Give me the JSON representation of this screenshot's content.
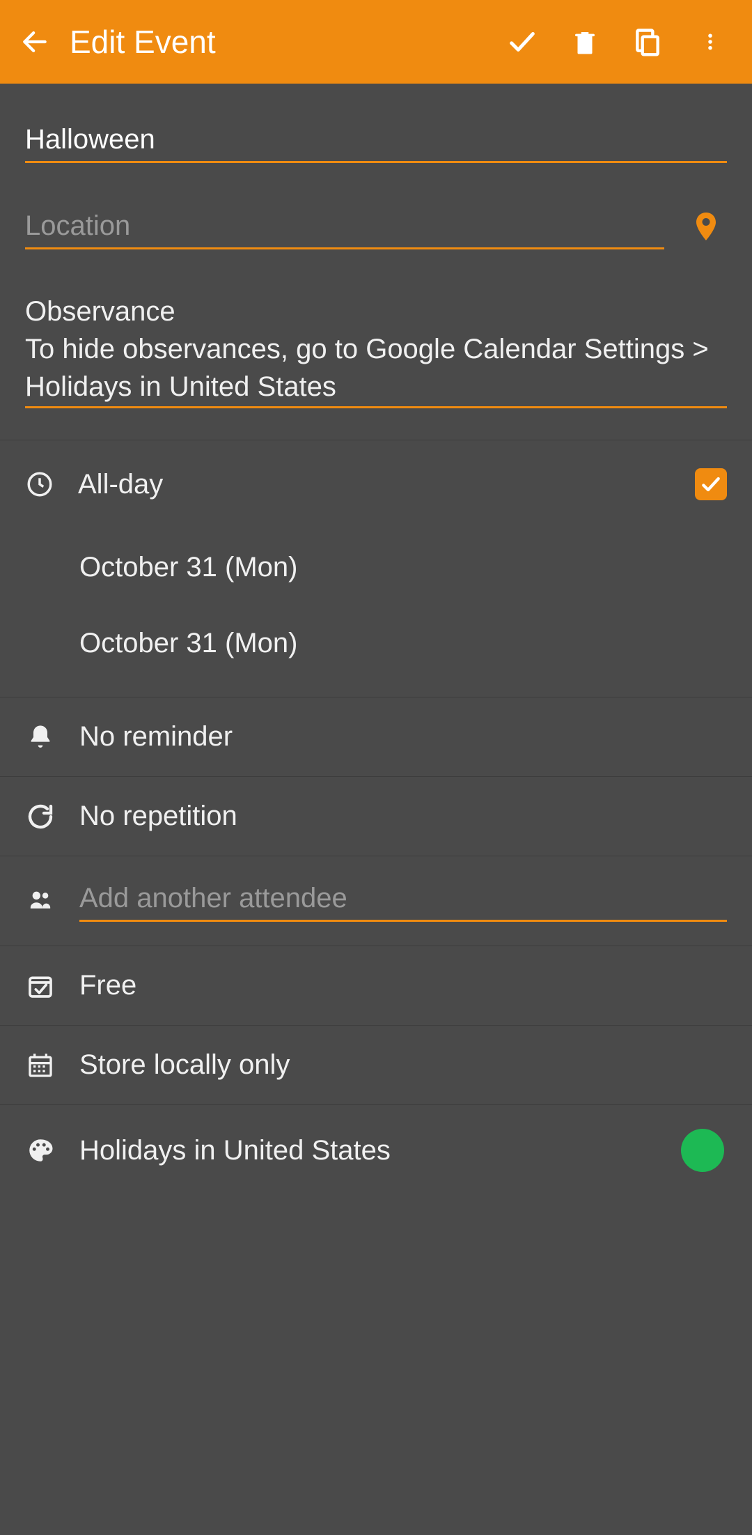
{
  "header": {
    "title": "Edit Event"
  },
  "event": {
    "title": "Halloween",
    "location_placeholder": "Location",
    "location": "",
    "description": "Observance\nTo hide observances, go to Google Calendar Settings > Holidays in United States"
  },
  "time": {
    "allday_label": "All-day",
    "allday_checked": true,
    "start": "October 31 (Mon)",
    "end": "October 31 (Mon)"
  },
  "reminder": {
    "label": "No reminder"
  },
  "repetition": {
    "label": "No repetition"
  },
  "attendees": {
    "placeholder": "Add another attendee"
  },
  "availability": {
    "label": "Free"
  },
  "storage": {
    "label": "Store locally only"
  },
  "event_type": {
    "label": "Holidays in United States",
    "color": "#1db954"
  },
  "colors": {
    "accent": "#f08b10"
  }
}
